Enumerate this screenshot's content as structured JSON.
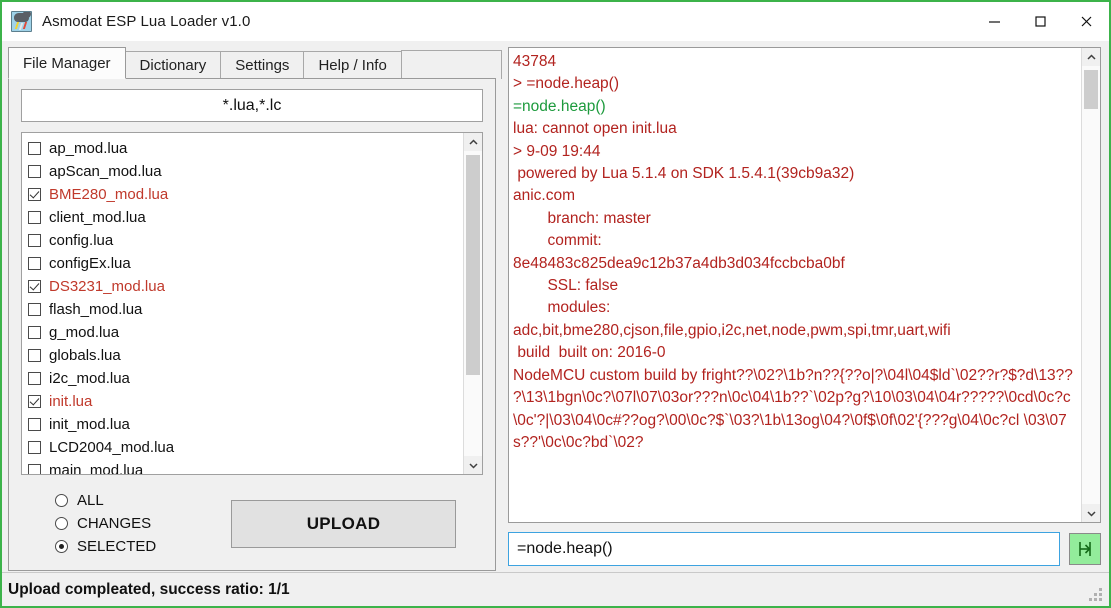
{
  "window": {
    "title": "Asmodat ESP Lua Loader v1.0",
    "icon": "storm-cloud-icon",
    "border_color": "#3cb34a",
    "controls": {
      "minimize": "—",
      "maximize": "□",
      "close": "✕"
    }
  },
  "tabs": [
    {
      "label": "File Manager",
      "active": true
    },
    {
      "label": "Dictionary",
      "active": false
    },
    {
      "label": "Settings",
      "active": false
    },
    {
      "label": "Help / Info",
      "active": false
    }
  ],
  "file_manager": {
    "filter_value": "*.lua,*.lc",
    "files": [
      {
        "name": "ap_mod.lua",
        "checked": false,
        "selected": false
      },
      {
        "name": "apScan_mod.lua",
        "checked": false,
        "selected": false
      },
      {
        "name": "BME280_mod.lua",
        "checked": true,
        "selected": true
      },
      {
        "name": "client_mod.lua",
        "checked": false,
        "selected": false
      },
      {
        "name": "config.lua",
        "checked": false,
        "selected": false
      },
      {
        "name": "configEx.lua",
        "checked": false,
        "selected": false
      },
      {
        "name": "DS3231_mod.lua",
        "checked": true,
        "selected": true
      },
      {
        "name": "flash_mod.lua",
        "checked": false,
        "selected": false
      },
      {
        "name": "g_mod.lua",
        "checked": false,
        "selected": false
      },
      {
        "name": "globals.lua",
        "checked": false,
        "selected": false
      },
      {
        "name": "i2c_mod.lua",
        "checked": false,
        "selected": false
      },
      {
        "name": "init.lua",
        "checked": true,
        "selected": true
      },
      {
        "name": "init_mod.lua",
        "checked": false,
        "selected": false
      },
      {
        "name": "LCD2004_mod.lua",
        "checked": false,
        "selected": false
      },
      {
        "name": "main_mod.lua",
        "checked": false,
        "selected": false
      }
    ],
    "selection_modes": [
      {
        "label": "ALL",
        "checked": false
      },
      {
        "label": "CHANGES",
        "checked": false
      },
      {
        "label": "SELECTED",
        "checked": true
      }
    ],
    "upload_label": "UPLOAD"
  },
  "console": {
    "lines": [
      {
        "text": "43784",
        "color": "red"
      },
      {
        "text": "> =node.heap()",
        "color": "red"
      },
      {
        "text": "=node.heap()",
        "color": "green"
      },
      {
        "text": "lua: cannot open init.lua",
        "color": "red"
      },
      {
        "text": "> 9-09 19:44",
        "color": "red"
      },
      {
        "text": " powered by Lua 5.1.4 on SDK 1.5.4.1(39cb9a32)",
        "color": "red"
      },
      {
        "text": "anic.com",
        "color": "red"
      },
      {
        "text": "        branch: master",
        "color": "red"
      },
      {
        "text": "        commit:",
        "color": "red"
      },
      {
        "text": "8e48483c825dea9c12b37a4db3d034fccbcba0bf",
        "color": "red"
      },
      {
        "text": "        SSL: false",
        "color": "red"
      },
      {
        "text": "        modules:",
        "color": "red"
      },
      {
        "text": "adc,bit,bme280,cjson,file,gpio,i2c,net,node,pwm,spi,tmr,uart,wifi",
        "color": "red"
      },
      {
        "text": " build  built on: 2016-0",
        "color": "red"
      },
      {
        "text": "NodeMCU custom build by fright??\\02?\\1b?n??{??o|?\\04l\\04$ld`\\02??r?$?d\\13??",
        "color": "red"
      },
      {
        "text": "?\\13\\1bgn\\0c?\\07l\\07\\03or???n\\0c\\04\\1b??`\\02p?g?\\10\\03\\04\\04r?????\\0cd\\0c?c\\0c'?|\\03\\04\\0c#??og?\\00\\0c?$`\\03?\\1b\\13og\\04?\\0f$\\0f\\02'{???g\\04\\0c?cl \\03\\07s??'\\0c\\0c?bd`\\02?",
        "color": "red"
      }
    ]
  },
  "command": {
    "value": "=node.heap()",
    "send_icon": "send-arrow-icon"
  },
  "status": {
    "message": "Upload compleated, success ratio: 1/1"
  }
}
